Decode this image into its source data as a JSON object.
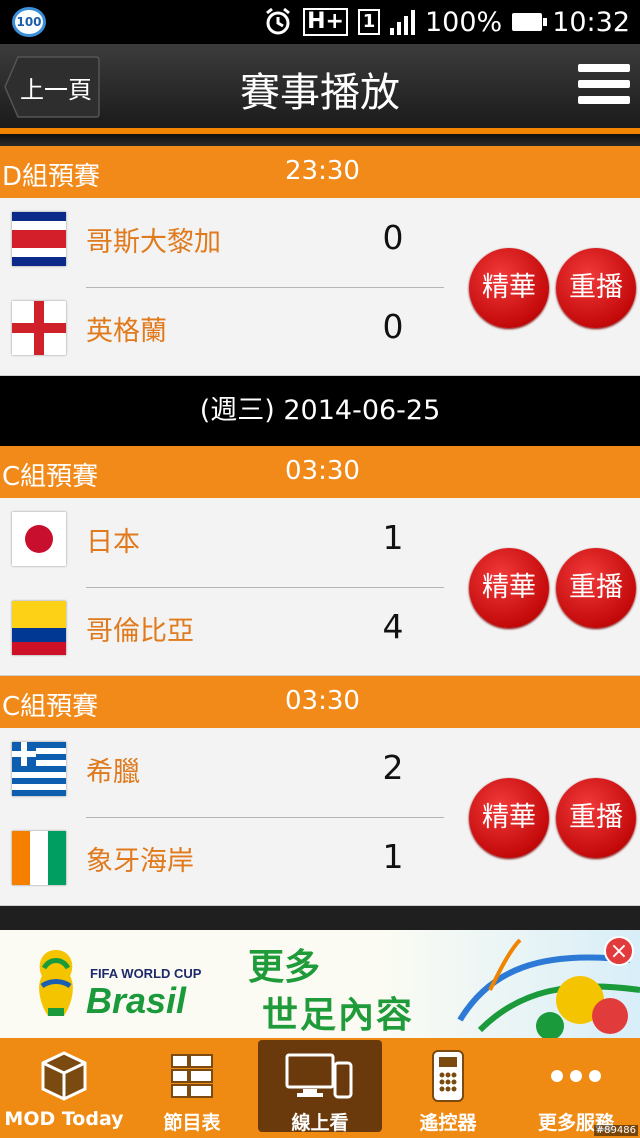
{
  "status_bar": {
    "badge": "100",
    "battery": "100%",
    "time": "10:32",
    "network": "H+",
    "sim": "1"
  },
  "header": {
    "back_label": "上一頁",
    "title": "賽事播放"
  },
  "sections": [
    {
      "group": "D組預賽",
      "time": "23:30",
      "teams": [
        {
          "name": "哥斯大黎加",
          "score": "0",
          "flag": "costa-rica-flag"
        },
        {
          "name": "英格蘭",
          "score": "0",
          "flag": "england-flag"
        }
      ],
      "highlight_label": "精華",
      "replay_label": "重播"
    },
    {
      "date": "(週三) 2014-06-25"
    },
    {
      "group": "C組預賽",
      "time": "03:30",
      "teams": [
        {
          "name": "日本",
          "score": "1",
          "flag": "japan-flag"
        },
        {
          "name": "哥倫比亞",
          "score": "4",
          "flag": "colombia-flag"
        }
      ],
      "highlight_label": "精華",
      "replay_label": "重播"
    },
    {
      "group": "C組預賽",
      "time": "03:30",
      "teams": [
        {
          "name": "希臘",
          "score": "2",
          "flag": "greece-flag"
        },
        {
          "name": "象牙海岸",
          "score": "1",
          "flag": "ivory-coast-flag"
        }
      ],
      "highlight_label": "精華",
      "replay_label": "重播"
    }
  ],
  "ad": {
    "fifa": "FIFA WORLD CUP",
    "brasil": "Brasil",
    "line1": "更多",
    "line2": "世足內容",
    "close": "×"
  },
  "bottom_nav": [
    {
      "label": "MOD Today",
      "icon": "cube-box-icon"
    },
    {
      "label": "節目表",
      "icon": "grid-list-icon"
    },
    {
      "label": "線上看",
      "icon": "monitor-phone-icon",
      "active": true
    },
    {
      "label": "遙控器",
      "icon": "remote-icon"
    },
    {
      "label": "更多服務",
      "icon": "more-dots-icon"
    }
  ],
  "watermark": "#89486",
  "colors": {
    "accent": "#f28a1a",
    "team_name": "#e07a1c",
    "button": "#c40a0a",
    "header": "#2a2a2a"
  }
}
